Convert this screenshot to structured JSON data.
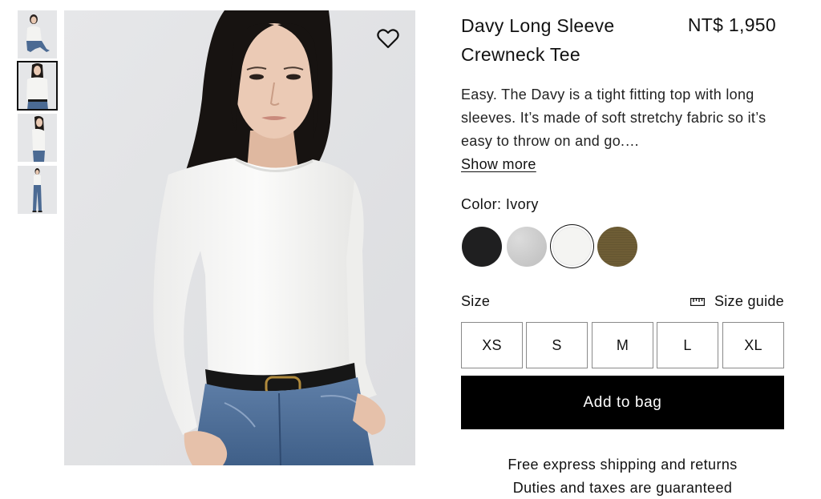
{
  "gallery": {
    "thumbnails": [
      {
        "alt": "thumbnail-1"
      },
      {
        "alt": "thumbnail-2"
      },
      {
        "alt": "thumbnail-3"
      },
      {
        "alt": "thumbnail-4"
      }
    ],
    "active_index": 1,
    "favorite_icon": "heart-icon"
  },
  "product": {
    "title": "Davy Long Sleeve Crewneck Tee",
    "price": "NT$ 1,950",
    "description": "Easy. The Davy is a tight fitting top with long sleeves. It’s made of soft stretchy fabric so it’s easy to throw on and go.…",
    "show_more": "Show more"
  },
  "color": {
    "label": "Color: Ivory",
    "swatches": [
      {
        "name": "Black",
        "hex": "#1f1f20"
      },
      {
        "name": "Heather Grey",
        "hex": "#c9c9c9"
      },
      {
        "name": "Ivory",
        "hex": "#f4f4f2"
      },
      {
        "name": "Olive",
        "hex": "#6e5d35"
      }
    ],
    "selected": "Ivory"
  },
  "size": {
    "label": "Size",
    "guide_label": "Size guide",
    "guide_icon": "ruler-icon",
    "options": [
      "XS",
      "S",
      "M",
      "L",
      "XL"
    ]
  },
  "cart": {
    "add_label": "Add to bag"
  },
  "shipping": {
    "line1": "Free express shipping and returns",
    "line2": "Duties and taxes are guaranteed"
  },
  "colors": {
    "primary_button": "#000000",
    "text": "#111111"
  }
}
